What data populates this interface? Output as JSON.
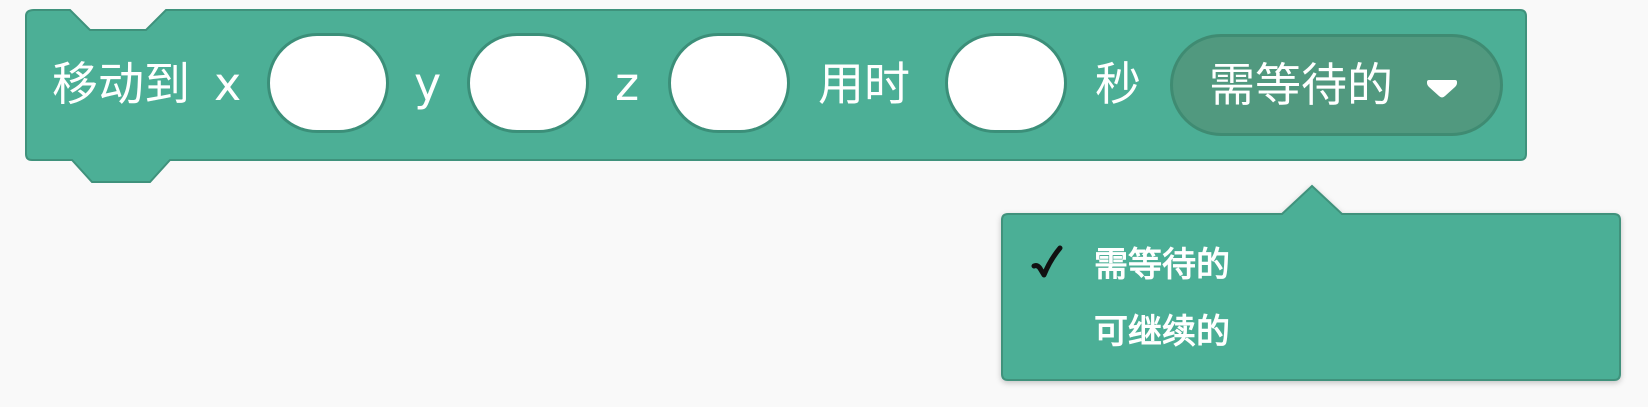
{
  "block": {
    "move_label": "移动到",
    "x_label": "x",
    "y_label": "y",
    "z_label": "z",
    "duration_label": "用时",
    "seconds_label": "秒",
    "x_value": "",
    "y_value": "",
    "z_value": "",
    "duration_value": "",
    "mode_selected": "需等待的",
    "color": "#4caf96"
  },
  "menu": {
    "items": [
      {
        "label": "需等待的",
        "checked": true
      },
      {
        "label": "可继续的",
        "checked": false
      }
    ],
    "color": "#4caf96"
  },
  "icons": {
    "dropdown_arrow": "caret-down-icon",
    "check": "checkmark-icon"
  }
}
